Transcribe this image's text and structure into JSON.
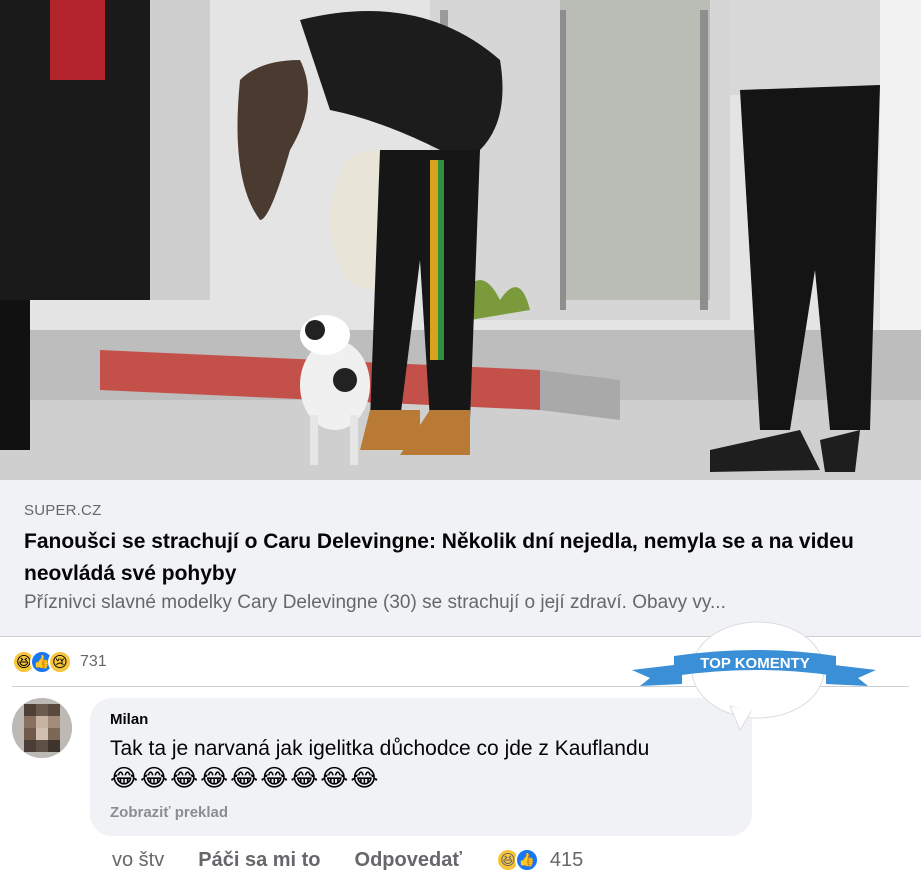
{
  "photo": {
    "alt_icon": "news-photo"
  },
  "preview": {
    "source": "SUPER.CZ",
    "headline": "Fanoušci se strachují o Caru Delevingne: Několik dní nejedla, nemyla se a na videu neovládá své pohyby",
    "description": "Příznivci slavné modelky Cary Delevingne (30) se strachují o její zdraví. Obavy vy..."
  },
  "reactions": {
    "icons": [
      "haha-icon",
      "like-icon",
      "sad-icon"
    ],
    "count": "731"
  },
  "badge": {
    "label": "TOP KOMENTY"
  },
  "comment": {
    "author": "Milan",
    "text": "Tak ta je narvaná jak igelitka důchodce co jde z Kauflandu",
    "emojis": "😂😂😂😂😂😂😂😂😂",
    "translate": "Zobraziť preklad"
  },
  "actions": {
    "time": "vo štv",
    "like": "Páči sa mi to",
    "reply": "Odpovedať",
    "reaction_count": "415"
  },
  "colors": {
    "accent": "#1877f2",
    "badge": "#3a8fd6",
    "text_secondary": "#65676b"
  }
}
